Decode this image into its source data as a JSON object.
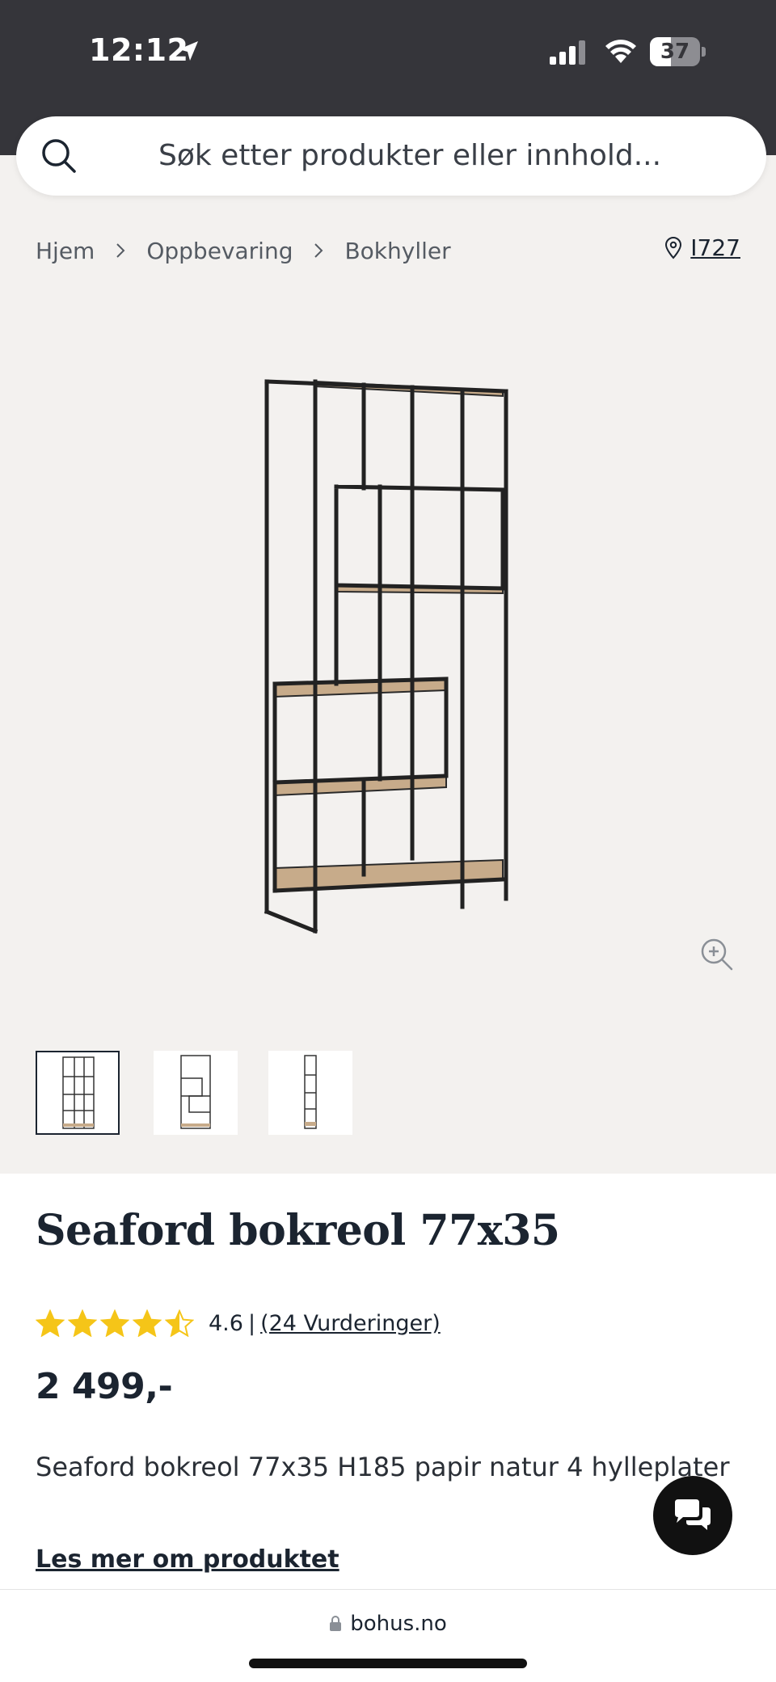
{
  "status_bar": {
    "time": "12:12",
    "battery": "37",
    "location_icon": "location-arrow-icon",
    "signal_icon": "cellular-signal-icon",
    "wifi_icon": "wifi-icon",
    "battery_icon": "battery-icon"
  },
  "search": {
    "placeholder": "Søk etter produkter eller innhold...",
    "icon": "search-icon"
  },
  "breadcrumb": {
    "items": [
      "Hjem",
      "Oppbevaring",
      "Bokhyller"
    ],
    "separator_icon": "chevron-right-icon"
  },
  "store": {
    "label": "I727",
    "icon": "location-pin-icon"
  },
  "gallery": {
    "zoom_icon": "zoom-in-icon",
    "thumbnail_count": 3,
    "active_thumbnail": 1
  },
  "product": {
    "title": "Seaford bokreol 77x35",
    "rating_value": "4.6",
    "rating_separator": "|",
    "rating_count": "(24 Vurderinger)",
    "rating_stars": 4.6,
    "star_color": "#f5c518",
    "price": "2 499,-",
    "description": "Seaford bokreol 77x35 H185 papir natur 4 hylleplater",
    "read_more": "Les mer om produktet"
  },
  "chat": {
    "icon": "chat-bubbles-icon"
  },
  "browser": {
    "url": "bohus.no",
    "lock_icon": "lock-icon"
  },
  "colors": {
    "status_bar_bg": "#35353a",
    "page_bg": "#f3f1ef",
    "text_dark": "#1b2430"
  }
}
